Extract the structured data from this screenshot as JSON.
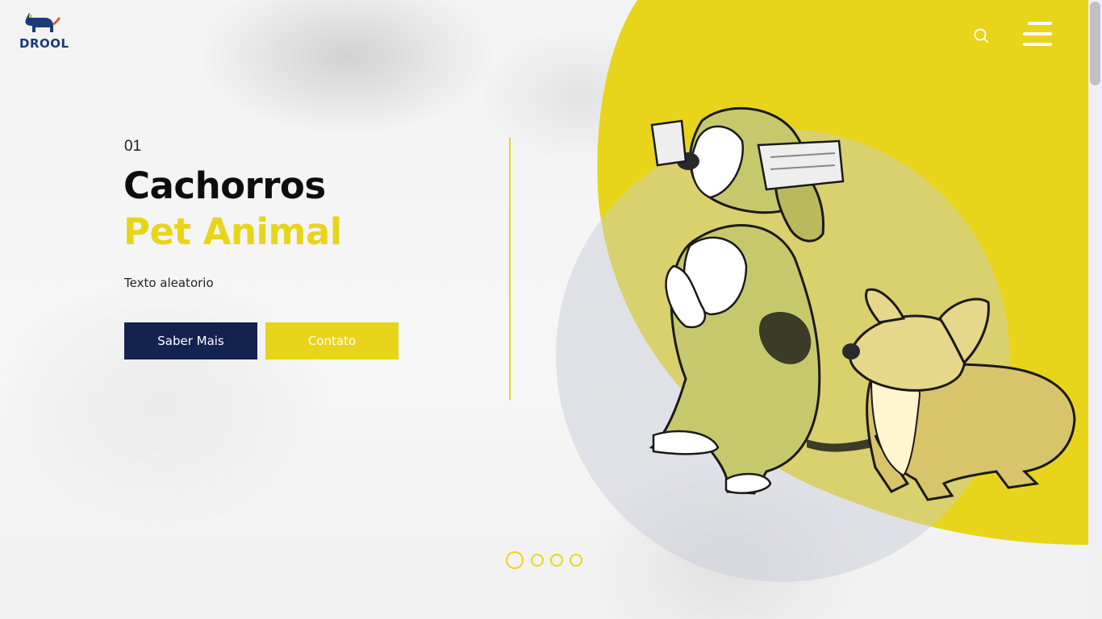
{
  "brand": {
    "name": "DROOL",
    "logo_icon": "dog-icon",
    "primary_color": "#13224f",
    "accent_color": "#e8d51b"
  },
  "header": {
    "search_icon": "search-icon",
    "menu_icon": "hamburger-menu-icon"
  },
  "hero": {
    "slide_number": "01",
    "title": "Cachorros",
    "subtitle": "Pet Animal",
    "text": "Texto aleatorio",
    "primary_button": "Saber Mais",
    "secondary_button": "Contato",
    "illustration": "cartoon-beagle-and-corgi-illustration"
  },
  "slider": {
    "total": 4,
    "active_index": 0
  }
}
